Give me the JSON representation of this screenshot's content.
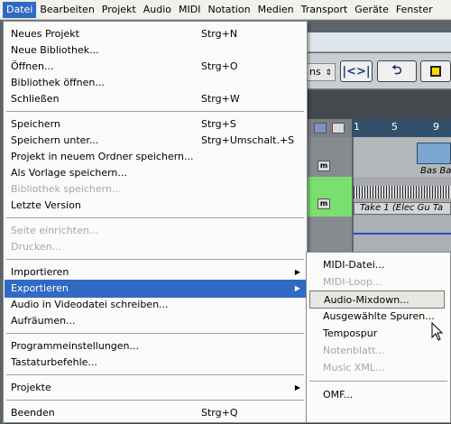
{
  "menubar": {
    "items": [
      "Datei",
      "Bearbeiten",
      "Projekt",
      "Audio",
      "MIDI",
      "Notation",
      "Medien",
      "Transport",
      "Geräte",
      "Fenster"
    ]
  },
  "background": {
    "field_text": "ns",
    "ruler_marks": [
      "1",
      "5",
      "9"
    ],
    "track2_part": "Bas Ba",
    "track3_part": "Take 1 (Elec Gu Ta",
    "mute_label": "m"
  },
  "file_menu": {
    "items": [
      {
        "label": "Neues Projekt",
        "shortcut": "Strg+N"
      },
      {
        "label": "Neue Bibliothek..."
      },
      {
        "label": "Öffnen...",
        "shortcut": "Strg+O"
      },
      {
        "label": "Bibliothek öffnen..."
      },
      {
        "label": "Schließen",
        "shortcut": "Strg+W"
      },
      {
        "label": "Speichern",
        "shortcut": "Strg+S"
      },
      {
        "label": "Speichern unter...",
        "shortcut": "Strg+Umschalt.+S"
      },
      {
        "label": "Projekt in neuem Ordner speichern..."
      },
      {
        "label": "Als Vorlage speichern..."
      },
      {
        "label": "Bibliothek speichern...",
        "disabled": true
      },
      {
        "label": "Letzte Version"
      },
      {
        "label": "Seite einrichten...",
        "disabled": true
      },
      {
        "label": "Drucken...",
        "disabled": true
      },
      {
        "label": "Importieren",
        "submenu": true
      },
      {
        "label": "Exportieren",
        "submenu": true,
        "highlighted": true
      },
      {
        "label": "Audio in Videodatei schreiben..."
      },
      {
        "label": "Aufräumen..."
      },
      {
        "label": "Programmeinstellungen..."
      },
      {
        "label": "Tastaturbefehle..."
      },
      {
        "label": "Projekte",
        "submenu": true
      },
      {
        "label": "Beenden",
        "shortcut": "Strg+Q"
      }
    ]
  },
  "export_submenu": {
    "items": [
      {
        "label": "MIDI-Datei..."
      },
      {
        "label": "MIDI-Loop...",
        "disabled": true
      },
      {
        "label": "Audio-Mixdown...",
        "hover": true
      },
      {
        "label": "Ausgewählte Spuren..."
      },
      {
        "label": "Tempospur"
      },
      {
        "label": "Notenblatt...",
        "disabled": true
      },
      {
        "label": "Music XML...",
        "disabled": true
      },
      {
        "label": "OMF..."
      }
    ]
  },
  "colors": {
    "highlight": "#316ac5",
    "disabled_text": "#a6a6a6",
    "menu_bg": "#fbfbf9"
  }
}
